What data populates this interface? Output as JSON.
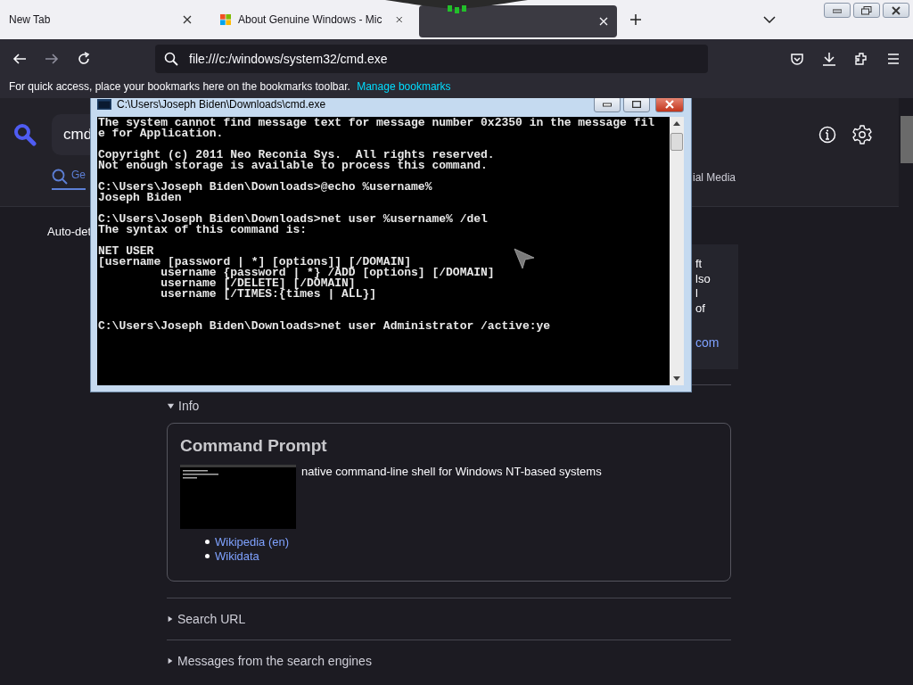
{
  "tabs": [
    {
      "title": "New Tab",
      "kind": "plain",
      "selected": false
    },
    {
      "title": "About Genuine Windows - Mic",
      "kind": "windows",
      "selected": false
    },
    {
      "kind": "plain",
      "selected": true
    }
  ],
  "address_bar": {
    "value": "file:///c:/windows/system32/cmd.exe"
  },
  "bookmarks_bar": {
    "text": "For quick access, place your bookmarks here on the bookmarks toolbar.",
    "link": "Manage bookmarks"
  },
  "search": {
    "value": "cmd"
  },
  "categories": [
    {
      "label": "Ge",
      "selected": true
    },
    {
      "label": "ial Media",
      "selected": false
    }
  ],
  "autodetect": "Auto-det",
  "side_panel": {
    "lines": [
      "ft",
      "lso",
      "l",
      "of"
    ],
    "link": "com"
  },
  "info": {
    "label": "Info",
    "expanded": true,
    "title": "Command Prompt",
    "description": "native command-line shell for Windows NT-based systems",
    "links": [
      "Wikipedia (en)",
      "Wikidata"
    ]
  },
  "sections": [
    {
      "label": "Search URL",
      "expanded": false
    },
    {
      "label": "Messages from the search engines",
      "expanded": false
    }
  ],
  "console_window": {
    "title": "C:\\Users\\Joseph Biden\\Downloads\\cmd.exe",
    "blocks": [
      [
        "The system cannot find message text for message number 0x2350 in the message fil",
        "e for Application."
      ],
      [
        "Copyright (c) 2011 Neo Reconia Sys.  All rights reserved.",
        "Not enough storage is available to process this command."
      ],
      [
        "C:\\Users\\Joseph Biden\\Downloads>@echo %username%",
        "Joseph Biden"
      ],
      [
        "C:\\Users\\Joseph Biden\\Downloads>net user %username% /del",
        "The syntax of this command is:"
      ],
      [
        "NET USER",
        "[username [password | *] [options]] [/DOMAIN]",
        "         username {password | *} /ADD [options] [/DOMAIN]",
        "         username [/DELETE] [/DOMAIN]",
        "         username [/TIMES:{times | ALL}]"
      ],
      [
        "C:\\Users\\Joseph Biden\\Downloads>net user Administrator /active:ye"
      ]
    ]
  }
}
